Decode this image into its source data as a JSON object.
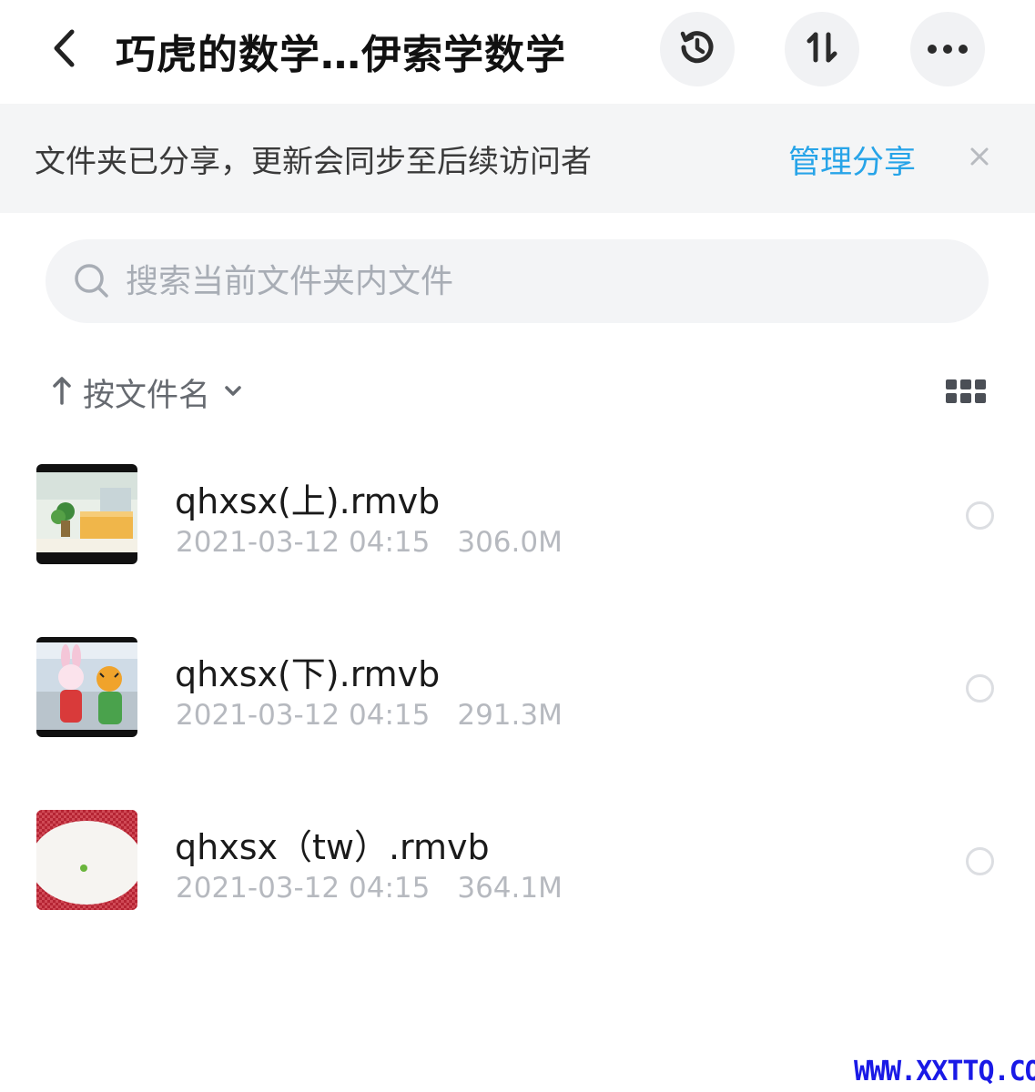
{
  "header": {
    "title": "巧虎的数学…伊索学数学",
    "back_icon": "chevron-left-icon",
    "history_icon": "history-icon",
    "sort_icon": "sort-toggle-icon",
    "more_icon": "more-horizontal-icon"
  },
  "banner": {
    "text": "文件夹已分享，更新会同步至后续访问者",
    "link": "管理分享",
    "link_color": "#27a4e8",
    "close_icon": "close-icon"
  },
  "search": {
    "placeholder": "搜索当前文件夹内文件",
    "value": ""
  },
  "sort": {
    "arrow": "↑",
    "label": "按文件名",
    "view_icon": "grid-view-icon"
  },
  "files": [
    {
      "name": "qhxsx(上).rmvb",
      "date": "2021-03-12 04:15",
      "size": "306.0M",
      "thumb": "office-scene-thumbnail"
    },
    {
      "name": "qhxsx(下).rmvb",
      "date": "2021-03-12 04:15",
      "size": "291.3M",
      "thumb": "characters-thumbnail"
    },
    {
      "name": "qhxsx（tw）.rmvb",
      "date": "2021-03-12 04:15",
      "size": "364.1M",
      "thumb": "red-oval-thumbnail"
    }
  ],
  "watermark": "WWW.XXTTQ.COM"
}
